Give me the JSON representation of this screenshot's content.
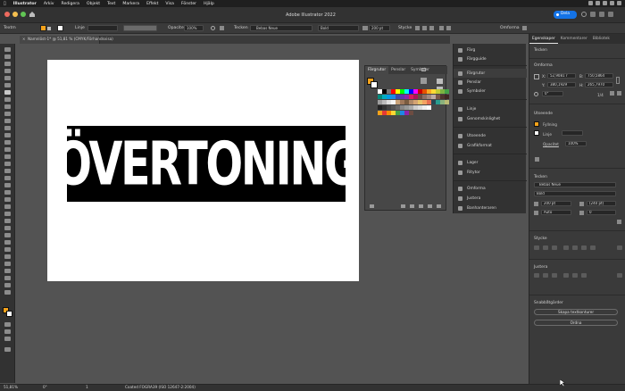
{
  "menubar": {
    "app": "Illustrator",
    "items": [
      "Arkiv",
      "Redigera",
      "Objekt",
      "Text",
      "Markera",
      "Effekt",
      "Visa",
      "Fönster",
      "Hjälp"
    ]
  },
  "titlebar": {
    "title": "Adobe Illustrator 2022",
    "share_label": "Dela",
    "traffic_colors": [
      "#ed6a5e",
      "#f5bf4f",
      "#61c554"
    ],
    "share_color": "#1473e6"
  },
  "control_bar": {
    "object_label": "Textm",
    "stroke_label": "Linje",
    "opacity_label": "Opacitet",
    "opacity_value": "100%",
    "char_label": "Tecken",
    "font_family": "Bebas Neue",
    "font_style": "Bold",
    "font_size": "200 pt",
    "paragraph_label": "Stycke",
    "transform_label": "Omforma",
    "fill_color": "#f4a21a"
  },
  "document_tab": {
    "label": "Namnlöst-1* @ 51,81 % (CMYK/Förhandsvisa)"
  },
  "artboard": {
    "text": "ÖVERTONING",
    "bg": "#ffffff",
    "banner_color": "#000000",
    "text_color": "#ffffff"
  },
  "swatches_panel": {
    "tabs": [
      "Färgrutor",
      "Penslar",
      "Symboler"
    ]
  },
  "dock": {
    "items": [
      "Färg",
      "Färgguide",
      "Färgrutor",
      "Penslar",
      "Symboler",
      "Linje",
      "Genomskinlighet",
      "Utseende",
      "Grafikformat",
      "Lager",
      "Ritytor",
      "Omforma",
      "Justera",
      "Banhanteraren"
    ]
  },
  "properties": {
    "tabs": [
      "Egenskaper",
      "Kommentarer",
      "Bibliotek"
    ],
    "sections": {
      "object": "Tecken",
      "transform": "Omforma",
      "appearance": "Utseende",
      "character": "Tecken",
      "paragraph": "Stycke",
      "align": "Justera",
      "quick_actions": "Snabbåtgärder"
    },
    "transform": {
      "x_label": "X:",
      "x": "52,9081 r",
      "w_label": "B:",
      "w": "750,5864",
      "y_label": "Y:",
      "y": "380,1929",
      "h_label": "H:",
      "h": "265,7970",
      "angle": "0°",
      "ratio": "1/4"
    },
    "appearance": {
      "fill_label": "Fyllning",
      "stroke_label": "Linje",
      "opacity_label": "Opacitet",
      "opacity_value": "100%"
    },
    "character": {
      "font": "Bebas Neue",
      "style": "Bold",
      "size": "200 pt",
      "leading": "(240 pt)",
      "kerning": "Auto",
      "tracking": "0"
    },
    "quick_actions": {
      "outline_button": "Skapa textkonturer",
      "arrange_button": "Ordna"
    }
  },
  "status_bar": {
    "zoom": "51,81%",
    "angle": "0°",
    "artboard_num": "1",
    "info": "Coated FOGRA39 (ISO 12647-2:2004)"
  }
}
